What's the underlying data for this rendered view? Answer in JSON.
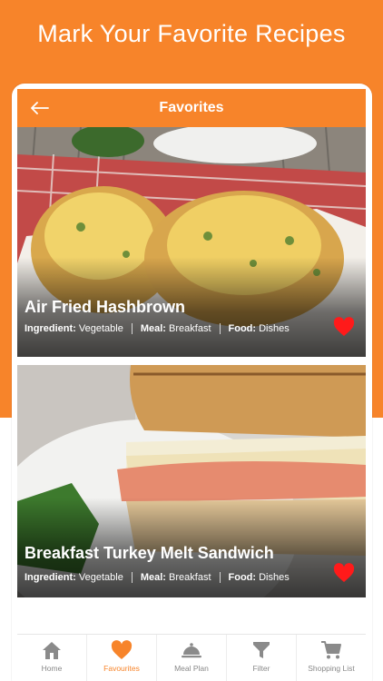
{
  "promo": {
    "title": "Mark Your Favorite Recipes"
  },
  "header": {
    "title": "Favorites"
  },
  "colors": {
    "accent": "#f7842a",
    "heart": "#ff1a1a"
  },
  "cards": [
    {
      "title": "Air Fried Hashbrown",
      "ingredient_label": "Ingredient:",
      "ingredient": "Vegetable",
      "meal_label": "Meal:",
      "meal": "Breakfast",
      "food_label": "Food:",
      "food": "Dishes",
      "favorite_icon": "heart-icon"
    },
    {
      "title": "Breakfast Turkey Melt Sandwich",
      "ingredient_label": "Ingredient:",
      "ingredient": "Vegetable",
      "meal_label": "Meal:",
      "meal": "Breakfast",
      "food_label": "Food:",
      "food": "Dishes",
      "favorite_icon": "heart-icon"
    }
  ],
  "tabs": [
    {
      "label": "Home",
      "icon": "home-icon",
      "active": false
    },
    {
      "label": "Favourites",
      "icon": "heart-icon",
      "active": true
    },
    {
      "label": "Meal Plan",
      "icon": "cloche-icon",
      "active": false
    },
    {
      "label": "Filter",
      "icon": "filter-icon",
      "active": false
    },
    {
      "label": "Shopping List",
      "icon": "cart-icon",
      "active": false
    }
  ]
}
